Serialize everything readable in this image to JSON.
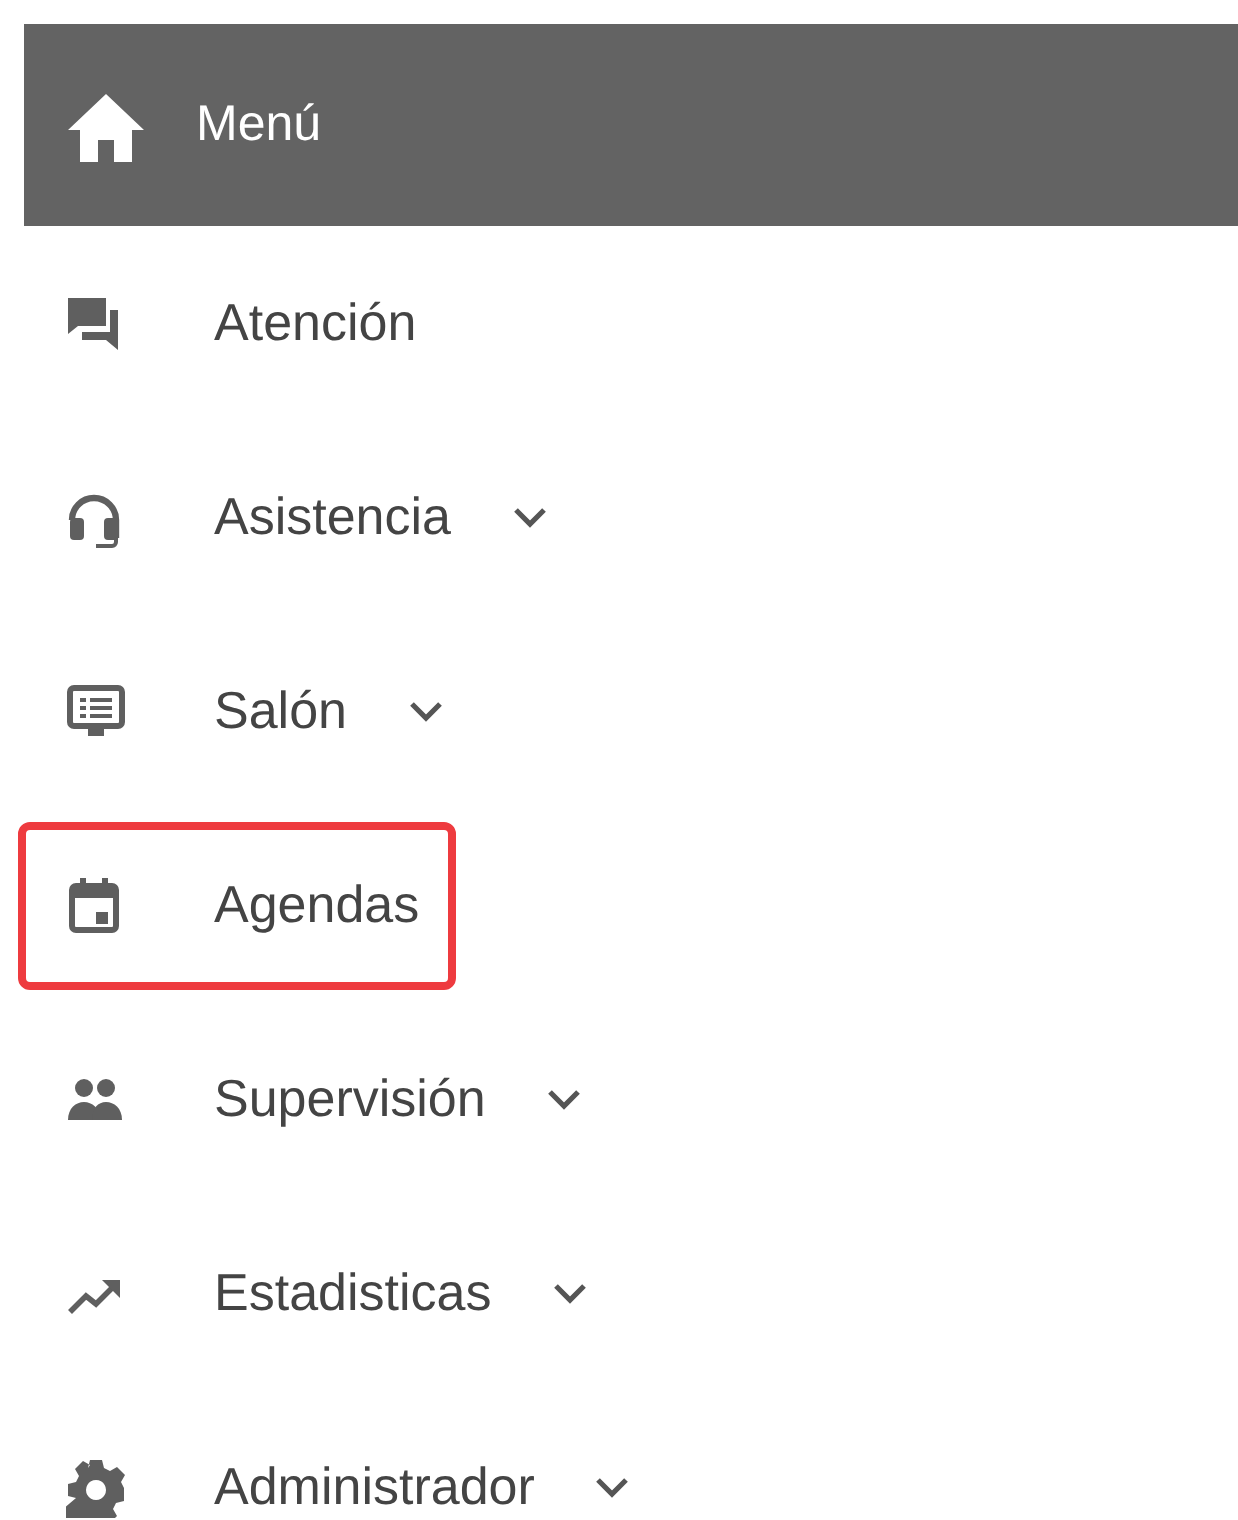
{
  "header": {
    "title": "Menú"
  },
  "menu_items": [
    {
      "kind": "chat",
      "label": "Atención",
      "has_submenu": false,
      "highlighted": false
    },
    {
      "kind": "headset",
      "label": "Asistencia",
      "has_submenu": true,
      "highlighted": false
    },
    {
      "kind": "monitor",
      "label": "Salón",
      "has_submenu": true,
      "highlighted": false
    },
    {
      "kind": "calendar",
      "label": "Agendas",
      "has_submenu": false,
      "highlighted": true
    },
    {
      "kind": "people",
      "label": "Supervisión",
      "has_submenu": true,
      "highlighted": false
    },
    {
      "kind": "trend",
      "label": "Estadisticas",
      "has_submenu": true,
      "highlighted": false
    },
    {
      "kind": "gear",
      "label": "Administrador",
      "has_submenu": true,
      "highlighted": false
    }
  ]
}
